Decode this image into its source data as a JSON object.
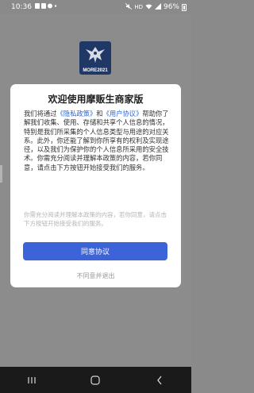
{
  "status_bar": {
    "time": "10:36",
    "battery": "96%"
  },
  "app": {
    "logo_text": "MORE",
    "logo_year": "2021"
  },
  "dialog": {
    "title": "欢迎使用摩贩生商家版",
    "body_intro": "我们将通过",
    "privacy_link": "《隐私政策》",
    "and": "和",
    "user_link": "《用户协议》",
    "body_rest": "帮助你了解我们收集、使用、存储和共享个人信息的情况，特别是我们所采集的个人信息类型与用途的对应关系。此外，你还能了解到你所享有的权利及实现途径，以及我们为保护你的个人信息所采用的安全技术。你需充分阅读并理解本政策的内容，若你同意，请点击下方按钮开始接受我们的服务。",
    "hint": "你需充分阅读并理解本政策的内容，若你同意，请点击下方按钮开始接受我们的服务。",
    "agree_label": "同意协议",
    "decline_label": "不同意并退出"
  },
  "nav": {
    "recents_icon": "recents-icon",
    "home_icon": "home-icon",
    "back_icon": "back-icon"
  }
}
